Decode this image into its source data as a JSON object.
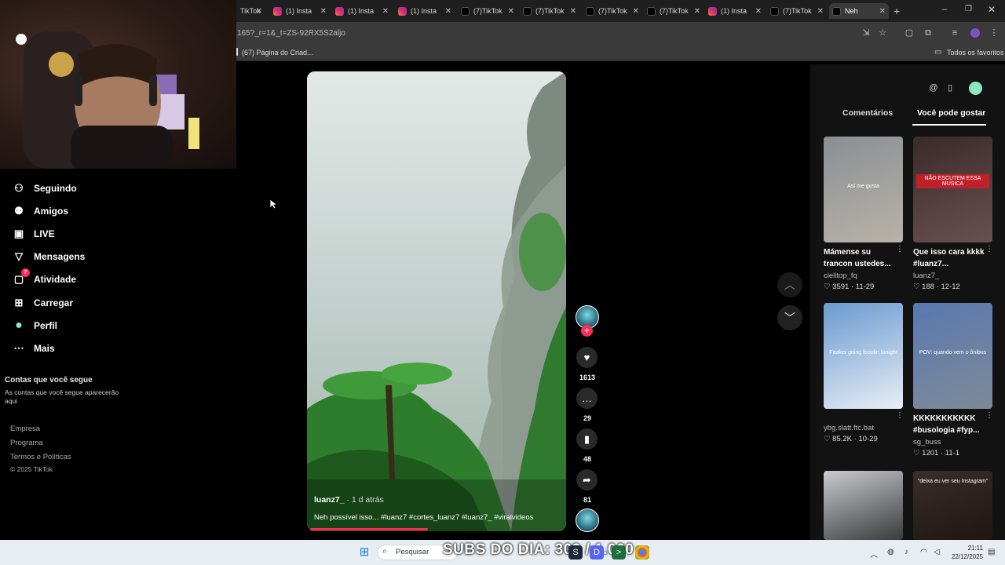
{
  "browser": {
    "tabs": [
      {
        "label": "TikTok",
        "kind": "tt"
      },
      {
        "label": "(1) Insta",
        "kind": "ig"
      },
      {
        "label": "(1) Insta",
        "kind": "ig"
      },
      {
        "label": "(1) Insta",
        "kind": "ig"
      },
      {
        "label": "(7)TikTok",
        "kind": "tt"
      },
      {
        "label": "(7)TikTok",
        "kind": "tt"
      },
      {
        "label": "(7)TikTok",
        "kind": "tt"
      },
      {
        "label": "(7)TikTok",
        "kind": "tt"
      },
      {
        "label": "(1) Insta",
        "kind": "ig"
      },
      {
        "label": "(7)TikTok",
        "kind": "tt"
      },
      {
        "label": "Neh",
        "kind": "tt",
        "active": true
      }
    ],
    "url": "165?_r=1&_t=ZS-92RX5S2aljo",
    "bookmark_left": "(67) Página do Criad...",
    "bookmark_right": "Todos os favoritos"
  },
  "sidebar": {
    "items": [
      {
        "label": "Seguindo",
        "icon": "following-icon"
      },
      {
        "label": "Amigos",
        "icon": "friends-icon"
      },
      {
        "label": "LIVE",
        "icon": "live-icon"
      },
      {
        "label": "Mensagens",
        "icon": "messages-icon"
      },
      {
        "label": "Atividade",
        "icon": "activity-icon",
        "badge": "7"
      },
      {
        "label": "Carregar",
        "icon": "upload-icon"
      },
      {
        "label": "Perfil",
        "icon": "profile-avatar"
      },
      {
        "label": "Mais",
        "icon": "more-icon"
      }
    ],
    "following_title": "Contas que você segue",
    "following_sub": "As contas que você segue aparecerão aqui",
    "footer": [
      "Empresa",
      "Programa",
      "Termos e Políticas",
      "© 2025 TikTok"
    ]
  },
  "video": {
    "author": "luanz7_",
    "time": " · 1 d atrás",
    "caption": "Neh possível isso... #luanz7 #cortes_luanz7 #luanz7_ #viralvideos",
    "progress": 0.46
  },
  "actions": {
    "likes": "1613",
    "comments": "29",
    "saves": "48",
    "shares": "81"
  },
  "right_panel": {
    "tabs": [
      "Comentários",
      "Você pode gostar"
    ],
    "active_tab": "Você pode gostar",
    "cards": [
      {
        "title": "Mámense su trancon ustedes...",
        "author": "cielitop_fq",
        "likes": "3591",
        "date": "11-29",
        "thumb_text": "Así me gusta",
        "colors": [
          "#8a8f94",
          "#b8b3a8"
        ]
      },
      {
        "title": "Que isso cara kkkk #luanz7...",
        "author": "luanz7_",
        "likes": "188",
        "date": "12-12",
        "thumb_text": "NÃO ESCUTEM ESSA MUSICA",
        "colors": [
          "#3a2a2a",
          "#6a5050"
        ]
      },
      {
        "title": "",
        "author": "ybg.slatt.ftc.bat",
        "likes": "85.2K",
        "date": "10-29",
        "thumb_text": "Faaker going fooolin tonight",
        "colors": [
          "#6a9ad0",
          "#e8eef5"
        ]
      },
      {
        "title": "KKKKKKKKKKK #busologia #fyp...",
        "author": "sg_buss",
        "likes": "1201",
        "date": "11-1",
        "thumb_text": "POV: quando vem o ônibus",
        "colors": [
          "#5a78b0",
          "#7d8a98"
        ]
      },
      {
        "title": "",
        "author": "",
        "likes": "",
        "date": "",
        "thumb_text": "",
        "colors": [
          "#c9cbcf",
          "#3a3a3a"
        ]
      },
      {
        "title": "",
        "author": "",
        "likes": "",
        "date": "",
        "thumb_text": "\"deixa eu ver seu Instagram\"",
        "colors": [
          "#3a2e28",
          "#1e1612"
        ]
      }
    ]
  },
  "taskbar": {
    "search_placeholder": "Pesquisar",
    "overlay": "SUBS DO DIA: 309 / 1.000",
    "time": "21:11",
    "date": "22/12/2025"
  },
  "colors": {
    "accent": "#fe2c55",
    "background": "#000000",
    "panel": "#121212"
  }
}
